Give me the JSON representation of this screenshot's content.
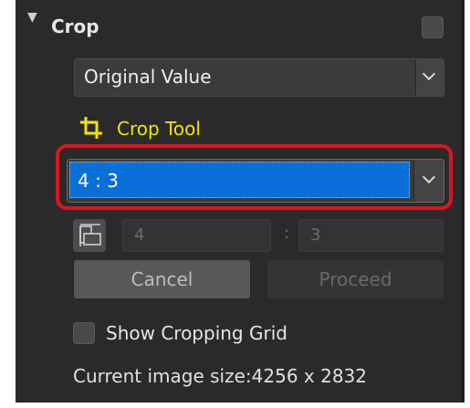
{
  "section": {
    "title": "Crop",
    "expanded_icon": "triangle-down-icon",
    "enabled": false
  },
  "preset_select": {
    "value": "Original Value"
  },
  "crop_tool": {
    "label": "Crop Tool",
    "icon": "crop-icon",
    "color": "#f4e500"
  },
  "aspect_select": {
    "value": "4 : 3",
    "highlight_color": "#e0141e",
    "selection_color": "#0a6fd8"
  },
  "ratio_fields": {
    "width": "4",
    "separator": ":",
    "height": "3",
    "swap_icon": "swap-orientation-icon"
  },
  "buttons": {
    "cancel": "Cancel",
    "proceed": "Proceed"
  },
  "grid_option": {
    "label": "Show Cropping Grid",
    "checked": false
  },
  "image_size": {
    "text": "Current image size:4256 x 2832"
  }
}
